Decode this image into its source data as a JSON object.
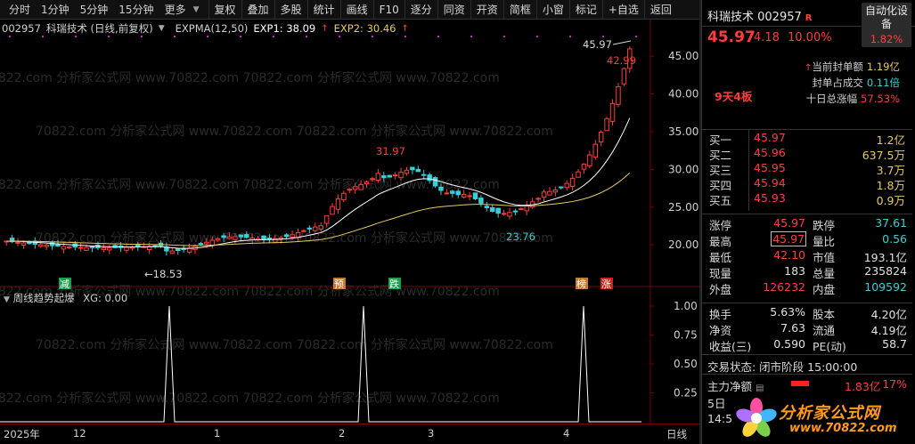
{
  "toolbar": {
    "periods": [
      "分时",
      "1分钟",
      "5分钟",
      "15分钟",
      "更多"
    ],
    "buttons": [
      "复权",
      "叠加",
      "多股",
      "统计",
      "画线",
      "F10",
      "逐分",
      "同资",
      "开资",
      "简框",
      "小窗",
      "标记",
      "+自选",
      "返回"
    ]
  },
  "legend": {
    "code": "002957",
    "name": "科瑞技术 (日线,前复权)",
    "indicator": "EXPMA(12,50)",
    "exp1": "EXP1: 38.09",
    "exp2": "EXP2: 30.46"
  },
  "sub_legend": {
    "label": "周线趋势起爆",
    "xg": "XG: 0.00"
  },
  "annotations": {
    "high_label": "45.97",
    "close_high_label": "42.99",
    "peak1": "31.97",
    "trough": "23.76",
    "low": "←18.53",
    "tags": [
      {
        "text": "减",
        "color": "#1aa04a"
      },
      {
        "text": "预",
        "color": "#c8782a"
      },
      {
        "text": "跌",
        "color": "#1aa04a"
      },
      {
        "text": "榜",
        "color": "#c8782a"
      },
      {
        "text": "涨",
        "color": "#d02020"
      }
    ]
  },
  "yaxis_main": [
    "45.00",
    "40.00",
    "35.00",
    "30.00",
    "25.00",
    "20.00"
  ],
  "yaxis_sub": [
    "1.00",
    "0.75",
    "0.50",
    "0.25"
  ],
  "xaxis": [
    "2025年",
    "12",
    "1",
    "2",
    "3",
    "4",
    "日线"
  ],
  "watermark": "70822.com 分析家公式网 www.70822.com",
  "panel": {
    "name": "科瑞技术 002957",
    "r_mark": "R",
    "price": "45.97",
    "change": "4.18",
    "pct": "10.00%",
    "tag_title": "自动化设备",
    "tag_pct": "1.82%",
    "seal_amount_label": "当前封单额",
    "seal_amount": "1.19亿",
    "seal_ratio_label": "封单占成交",
    "seal_ratio": "0.11倍",
    "ten_day_label": "十日总涨幅",
    "ten_day": "57.53%",
    "days_boards": "9天4板",
    "orderbook": [
      {
        "label": "买一",
        "price": "45.97",
        "qty": "1.2亿"
      },
      {
        "label": "买二",
        "price": "45.96",
        "qty": "637.5万"
      },
      {
        "label": "买三",
        "price": "45.95",
        "qty": "3.7万"
      },
      {
        "label": "买四",
        "price": "45.94",
        "qty": "1.8万"
      },
      {
        "label": "买五",
        "price": "45.93",
        "qty": "0.9万"
      }
    ],
    "stats": [
      {
        "l1": "涨停",
        "v1": "45.97",
        "c1": "red",
        "l2": "跌停",
        "v2": "37.61",
        "c2": "cyan"
      },
      {
        "l1": "最高",
        "v1": "45.97",
        "c1": "red",
        "l2": "量比",
        "v2": "0.56",
        "c2": "cyan"
      },
      {
        "l1": "最低",
        "v1": "42.10",
        "c1": "red",
        "l2": "市值",
        "v2": "193.1亿",
        "c2": "white"
      },
      {
        "l1": "现量",
        "v1": "183",
        "c1": "white",
        "l2": "总量",
        "v2": "235824",
        "c2": "white"
      },
      {
        "l1": "外盘",
        "v1": "126232",
        "c1": "red",
        "l2": "内盘",
        "v2": "109592",
        "c2": "cyan"
      }
    ],
    "stats2": [
      {
        "l1": "换手",
        "v1": "5.63%",
        "c1": "white",
        "l2": "股本",
        "v2": "4.20亿",
        "c2": "white"
      },
      {
        "l1": "净资",
        "v1": "7.63",
        "c1": "white",
        "l2": "流通",
        "v2": "4.19亿",
        "c2": "white"
      },
      {
        "l1": "收益(三)",
        "v1": "0.590",
        "c1": "white",
        "l2": "PE(动)",
        "v2": "58.7",
        "c2": "white"
      }
    ],
    "trade_status": "交易状态: 闭市阶段 15:00:00",
    "flow_label": "主力净额",
    "flow_value": "1.83亿",
    "flow_pct": "17%",
    "misc1": "5日",
    "misc2": "14:5"
  },
  "logo": {
    "cn": "分析家公式网",
    "url": "www.70822.com"
  },
  "chart_data": {
    "type": "candlestick",
    "y_range": [
      17.5,
      47.5
    ],
    "exp1_last": 38.09,
    "exp2_last": 30.46,
    "high": 45.97,
    "low": 18.53,
    "sub_signal_peaks": [
      1,
      1,
      1
    ],
    "sub_y_range": [
      0,
      1
    ]
  }
}
